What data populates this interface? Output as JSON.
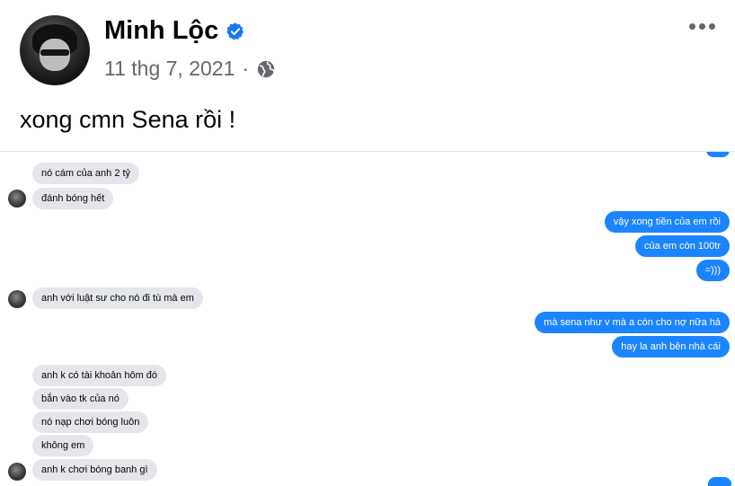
{
  "post": {
    "author": "Minh Lộc",
    "date": "11 thg 7, 2021",
    "separator": "·",
    "caption": "xong cmn Sena rồi !",
    "icons": {
      "verified": "verified-badge-icon",
      "privacy": "globe-icon",
      "more": "more-options-icon"
    },
    "accent_color": "#1877f2"
  },
  "chat": {
    "incoming_color": "#e4e6eb",
    "outgoing_color": "#1b84ff",
    "messages": [
      {
        "side": "in",
        "text": "nó cám của anh 2 tỷ"
      },
      {
        "side": "in",
        "text": "đánh bóng hết"
      },
      {
        "side": "out",
        "text": "vậy xong tiền của em rồi"
      },
      {
        "side": "out",
        "text": "của em còn 100tr"
      },
      {
        "side": "out",
        "text": "=)))"
      },
      {
        "side": "in",
        "text": "anh với luật sư cho nó đi tù mà em"
      },
      {
        "side": "out",
        "text": "mà sena như v mà a còn cho nợ nữa hả"
      },
      {
        "side": "out",
        "text": "hay la anh bên nhà cái"
      },
      {
        "side": "in",
        "text": "anh k có tài khoản hôm đó"
      },
      {
        "side": "in",
        "text": "bắn vào tk của nó"
      },
      {
        "side": "in",
        "text": "nó nạp chơi bóng luôn"
      },
      {
        "side": "in",
        "text": "không em"
      },
      {
        "side": "in",
        "text": "anh k chơi bóng banh gì"
      }
    ]
  }
}
